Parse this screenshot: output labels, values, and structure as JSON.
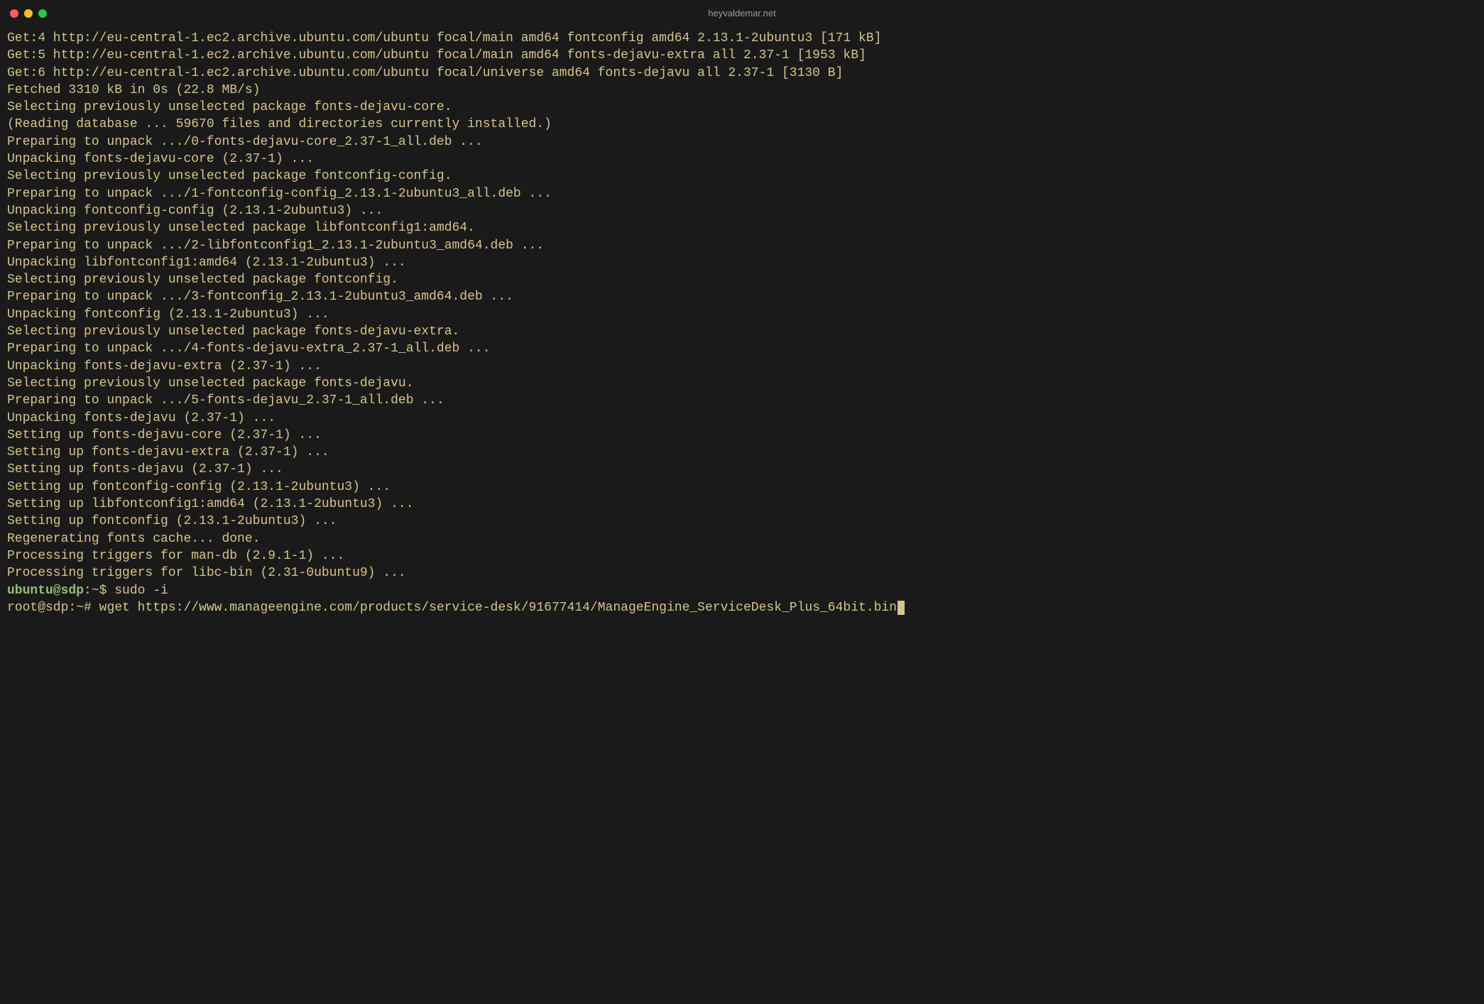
{
  "window": {
    "title": "heyvaldemar.net"
  },
  "colors": {
    "bg": "#1a1a1a",
    "fg": "#d6c58a",
    "prompt_user": "#8ec07c",
    "traffic_close": "#ff5f57",
    "traffic_min": "#febc2e",
    "traffic_max": "#28c840"
  },
  "output_lines": [
    "Get:4 http://eu-central-1.ec2.archive.ubuntu.com/ubuntu focal/main amd64 fontconfig amd64 2.13.1-2ubuntu3 [171 kB]",
    "Get:5 http://eu-central-1.ec2.archive.ubuntu.com/ubuntu focal/main amd64 fonts-dejavu-extra all 2.37-1 [1953 kB]",
    "Get:6 http://eu-central-1.ec2.archive.ubuntu.com/ubuntu focal/universe amd64 fonts-dejavu all 2.37-1 [3130 B]",
    "Fetched 3310 kB in 0s (22.8 MB/s)",
    "Selecting previously unselected package fonts-dejavu-core.",
    "(Reading database ... 59670 files and directories currently installed.)",
    "Preparing to unpack .../0-fonts-dejavu-core_2.37-1_all.deb ...",
    "Unpacking fonts-dejavu-core (2.37-1) ...",
    "Selecting previously unselected package fontconfig-config.",
    "Preparing to unpack .../1-fontconfig-config_2.13.1-2ubuntu3_all.deb ...",
    "Unpacking fontconfig-config (2.13.1-2ubuntu3) ...",
    "Selecting previously unselected package libfontconfig1:amd64.",
    "Preparing to unpack .../2-libfontconfig1_2.13.1-2ubuntu3_amd64.deb ...",
    "Unpacking libfontconfig1:amd64 (2.13.1-2ubuntu3) ...",
    "Selecting previously unselected package fontconfig.",
    "Preparing to unpack .../3-fontconfig_2.13.1-2ubuntu3_amd64.deb ...",
    "Unpacking fontconfig (2.13.1-2ubuntu3) ...",
    "Selecting previously unselected package fonts-dejavu-extra.",
    "Preparing to unpack .../4-fonts-dejavu-extra_2.37-1_all.deb ...",
    "Unpacking fonts-dejavu-extra (2.37-1) ...",
    "Selecting previously unselected package fonts-dejavu.",
    "Preparing to unpack .../5-fonts-dejavu_2.37-1_all.deb ...",
    "Unpacking fonts-dejavu (2.37-1) ...",
    "Setting up fonts-dejavu-core (2.37-1) ...",
    "Setting up fonts-dejavu-extra (2.37-1) ...",
    "Setting up fonts-dejavu (2.37-1) ...",
    "Setting up fontconfig-config (2.13.1-2ubuntu3) ...",
    "Setting up libfontconfig1:amd64 (2.13.1-2ubuntu3) ...",
    "Setting up fontconfig (2.13.1-2ubuntu3) ...",
    "Regenerating fonts cache... done.",
    "Processing triggers for man-db (2.9.1-1) ...",
    "Processing triggers for libc-bin (2.31-0ubuntu9) ..."
  ],
  "prompts": [
    {
      "user": "ubuntu@sdp",
      "sep": ":",
      "path": "~",
      "symbol": "$",
      "command": "sudo -i",
      "cursor": false
    },
    {
      "user": "root@sdp",
      "sep": ":",
      "path": "~",
      "symbol": "#",
      "command": "wget https://www.manageengine.com/products/service-desk/91677414/ManageEngine_ServiceDesk_Plus_64bit.bin",
      "cursor": true,
      "user_plain": true
    }
  ]
}
